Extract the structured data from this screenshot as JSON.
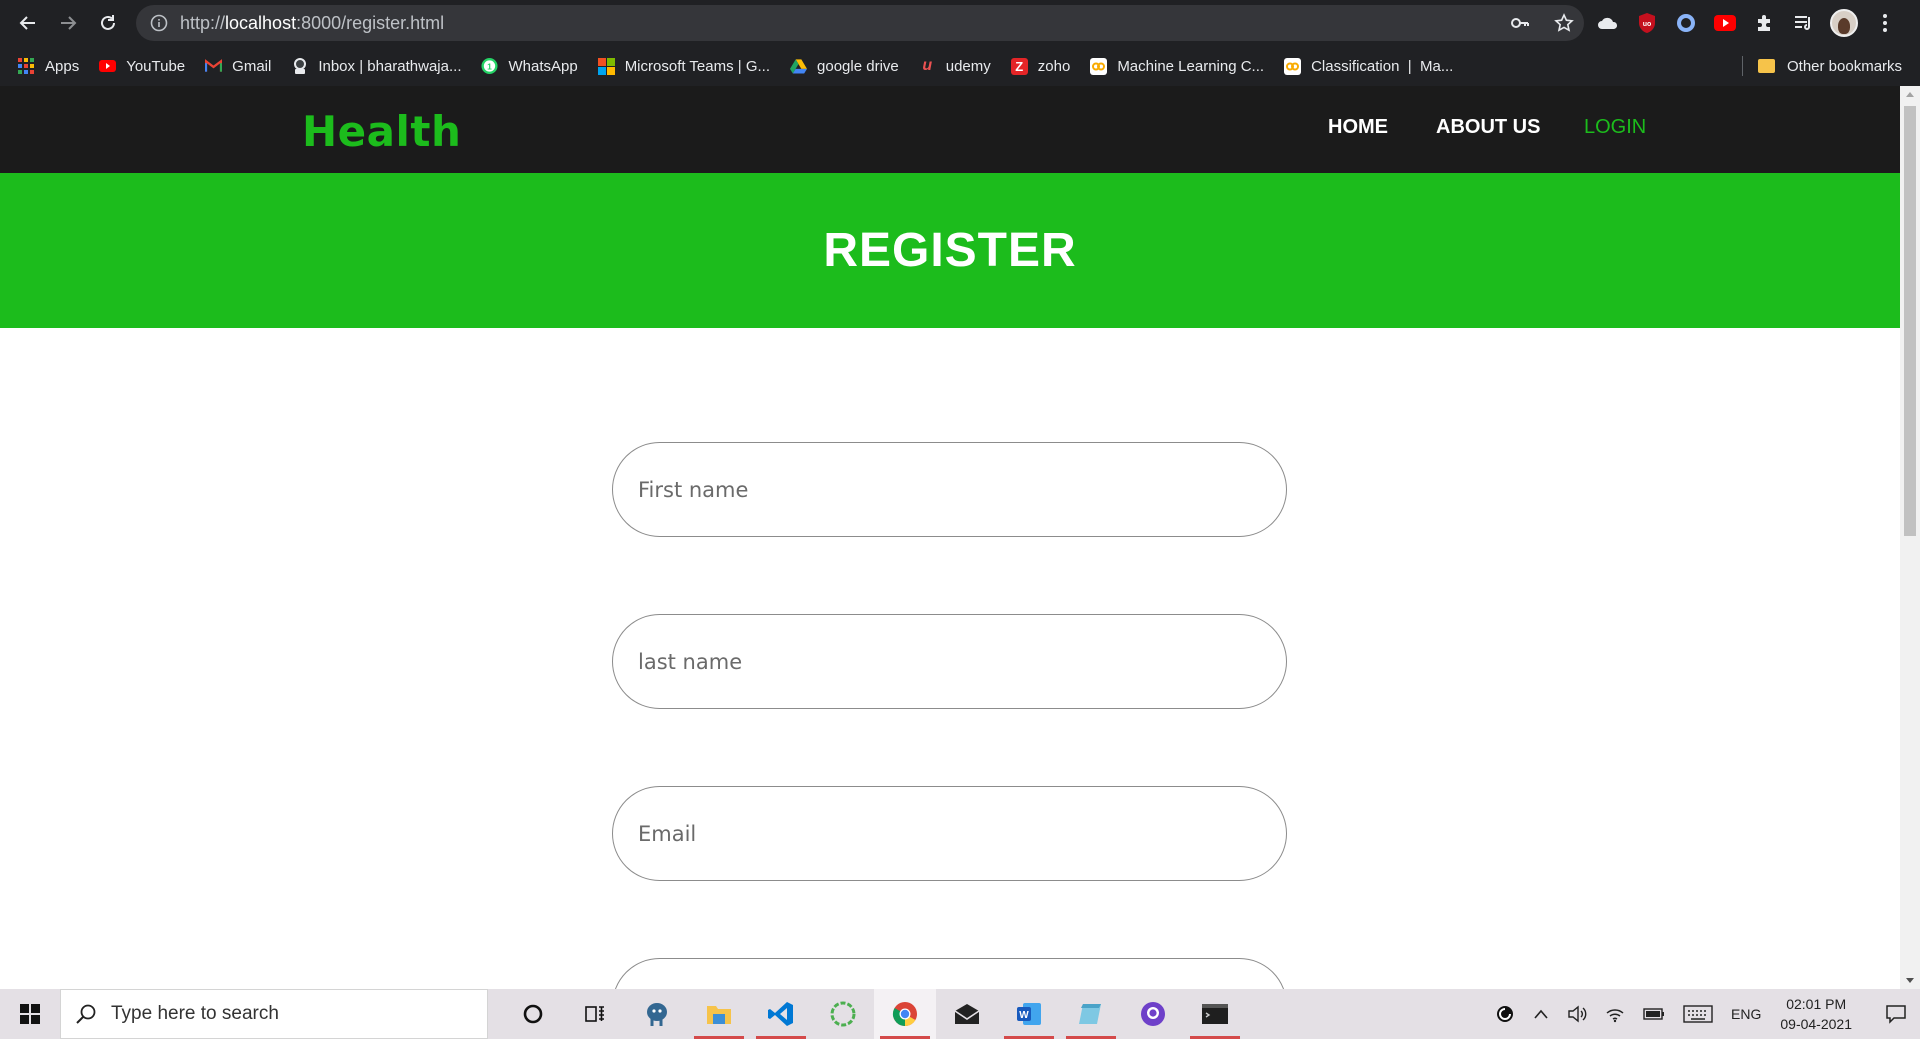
{
  "browser": {
    "url_prefix": "http://",
    "url_host": "localhost",
    "url_rest": ":8000/register.html",
    "bookmarks": [
      {
        "label": "Apps",
        "icon": "apps-grid-icon",
        "color": "#ea4335"
      },
      {
        "label": "YouTube",
        "icon": "youtube-icon",
        "color": "#ff0000"
      },
      {
        "label": "Gmail",
        "icon": "gmail-icon",
        "color": "#ea4335"
      },
      {
        "label": "Inbox | bharathwaja...",
        "icon": "inbox-icon",
        "color": "#5f6368"
      },
      {
        "label": "WhatsApp",
        "icon": "whatsapp-icon",
        "color": "#25d366"
      },
      {
        "label": "Microsoft Teams | G...",
        "icon": "microsoft-icon",
        "color": "#f25022"
      },
      {
        "label": "google drive",
        "icon": "google-drive-icon",
        "color": "#1fa463"
      },
      {
        "label": "udemy",
        "icon": "udemy-icon",
        "color": "#ec5252"
      },
      {
        "label": "zoho",
        "icon": "zoho-icon",
        "color": "#e42527"
      },
      {
        "label": "Machine Learning C...",
        "icon": "colab-icon",
        "color": "#ffffff"
      },
      {
        "label": "Classification  |  Ma...",
        "icon": "colab-icon",
        "color": "#ffffff"
      }
    ],
    "other_bookmarks": "Other bookmarks"
  },
  "site": {
    "logo": "Health",
    "nav": {
      "home": "HOME",
      "about": "ABOUT US",
      "login": "LOGIN"
    },
    "page_heading": "REGISTER",
    "form": {
      "first_name_placeholder": "First name",
      "last_name_placeholder": "last name",
      "email_placeholder": "Email"
    },
    "brand_color": "#1cbc1c"
  },
  "taskbar": {
    "search_placeholder": "Type here to search",
    "language": "ENG",
    "time": "02:01 PM",
    "date": "09-04-2021"
  }
}
